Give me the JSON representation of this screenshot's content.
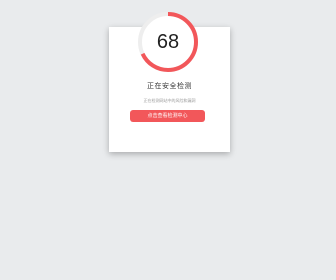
{
  "security_check": {
    "score": "68",
    "progress_fraction": 0.68,
    "title": "正在安全检测",
    "description": "正在检测网站中的风险和漏洞",
    "button_label": "点击查看检测中心"
  },
  "colors": {
    "background": "#e9ebed",
    "card": "#ffffff",
    "accent": "#f2575a",
    "ring_track": "#eeeeee"
  }
}
